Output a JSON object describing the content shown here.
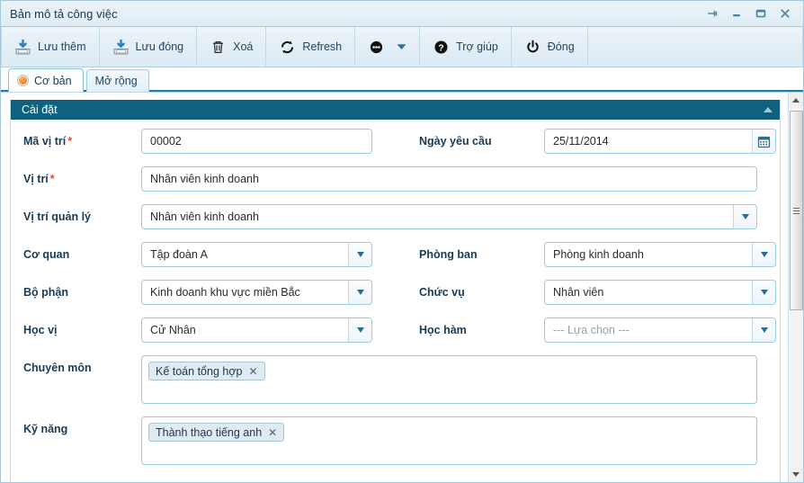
{
  "window": {
    "title": "Bản mô tả công việc",
    "controls": [
      {
        "name": "pin-icon",
        "label": "Pin"
      },
      {
        "name": "minimize-icon",
        "label": "Minimize"
      },
      {
        "name": "maximize-icon",
        "label": "Maximize"
      },
      {
        "name": "close-icon",
        "label": "Close"
      }
    ]
  },
  "toolbar": {
    "buttons": [
      {
        "label": "Lưu thêm",
        "icon": "save-add-icon"
      },
      {
        "label": "Lưu đóng",
        "icon": "save-close-icon"
      },
      {
        "label": "Xoá",
        "icon": "trash-icon"
      },
      {
        "label": "Refresh",
        "icon": "refresh-icon"
      },
      {
        "label": "",
        "icon": "more-options-icon"
      },
      {
        "label": "Trợ giúp",
        "icon": "help-icon"
      },
      {
        "label": "Đóng",
        "icon": "power-icon"
      }
    ]
  },
  "tabs": [
    {
      "label": "Cơ bản",
      "active": true
    },
    {
      "label": "Mở rộng",
      "active": false
    }
  ],
  "panel": {
    "title": "Cài đặt",
    "fields": {
      "ma_vi_tri": {
        "label": "Mã vị trí",
        "required": true,
        "value": "00002"
      },
      "ngay_yeu_cau": {
        "label": "Ngày yêu cầu",
        "required": false,
        "value": "25/11/2014"
      },
      "vi_tri": {
        "label": "Vị trí",
        "required": true,
        "value": "Nhân viên kinh doanh"
      },
      "vi_tri_quan_ly": {
        "label": "Vị trí quản lý",
        "required": false,
        "value": "Nhân viên kinh doanh"
      },
      "co_quan": {
        "label": "Cơ quan",
        "required": false,
        "value": "Tập đoàn A"
      },
      "phong_ban": {
        "label": "Phòng ban",
        "required": false,
        "value": "Phòng kinh doanh"
      },
      "bo_phan": {
        "label": "Bộ phận",
        "required": false,
        "value": "Kinh doanh khu vực miền Bắc"
      },
      "chuc_vu": {
        "label": "Chức vụ",
        "required": false,
        "value": "Nhân viên"
      },
      "hoc_vi": {
        "label": "Học vị",
        "required": false,
        "value": "Cử Nhân"
      },
      "hoc_ham": {
        "label": "Học hàm",
        "required": false,
        "value": "--- Lựa chọn ---",
        "is_placeholder": true
      },
      "chuyen_mon": {
        "label": "Chuyên môn",
        "required": false,
        "tags": [
          "Kế toán tổng hợp"
        ]
      },
      "ky_nang": {
        "label": "Kỹ năng",
        "required": false,
        "tags": [
          "Thành thạo tiếng anh"
        ]
      }
    }
  },
  "colors": {
    "panel_header": "#10607f",
    "title_text": "#17374d",
    "required_star": "#e0492f",
    "tab_accent": "#1a7fa8",
    "field_border": "#9ecadf"
  }
}
